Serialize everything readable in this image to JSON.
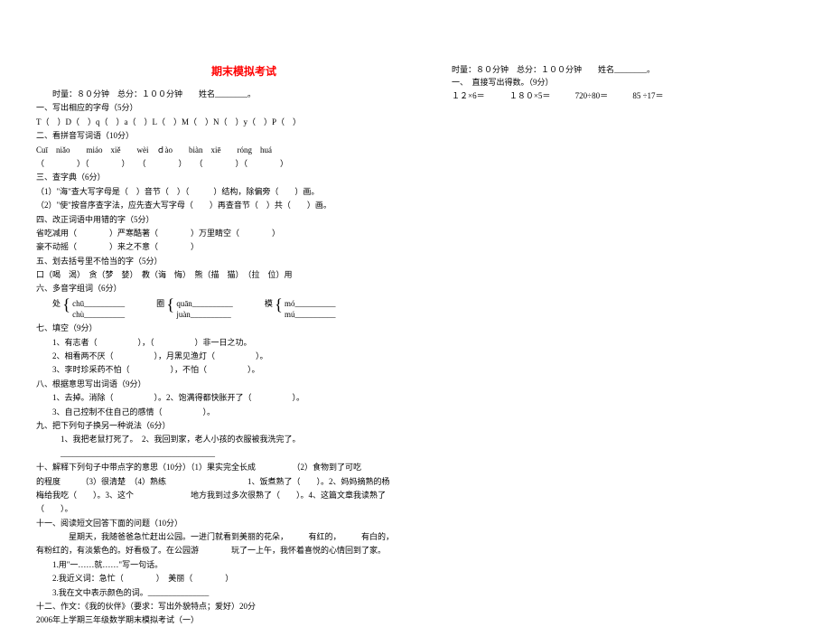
{
  "title": "期末模拟考试",
  "left": {
    "header_info": "时量：８０分钟　总分：１００分钟　　姓名________。",
    "section1_title": "一、写出相应的字母（5分）",
    "section1_content": "T（　）D（　）q（　）a（　）L（　）M（　）N（　）y（　）P（　）",
    "section2_title": "二、看拼音写词语（10分）",
    "section2_pinyin": "Cuī　niǎo　　miáo　xiě　　wèi　ｄào　　biàn　xiē　　róng　huá",
    "section2_blanks": "（　　　　）（　　　　）　　（　　　　）　　（　　　　）（　　　　）",
    "section3_title": "三、查字典（6分）",
    "section3_line1": "（1）\"海\"查大写字母是（　）音节（　）（　　　）结构，除偏旁（　　）画。",
    "section3_line2": "（2）\"使\"按音序查字法，应先查大写字母（　　）再查音节（　）共（　　）画。",
    "section4_title": "四、改正词语中用错的字（5分）",
    "section4_line1": "省吃减用（　　　　）严寒酷著（　　　　）万里睛空（　　　　）",
    "section4_line2": "豪不动摇（　　　　）来之不意（　　　　）",
    "section5_title": "五、划去括号里不恰当的字（5分）",
    "section5_content": "口（喝　渴）　贪（梦　婪）　教（诲　悔）　熊（描　猫）　（拉　位）用",
    "section6_title": "六、多音字组词（6分）",
    "section6_char1": "处",
    "section6_pinyin1a": "chū__________",
    "section6_pinyin1b": "chù__________",
    "section6_char2": "圈",
    "section6_pinyin2a": "quān__________",
    "section6_pinyin2b": "juàn__________",
    "section6_char3": "模",
    "section6_pinyin3a": "mó__________",
    "section6_pinyin3b": "mú__________",
    "section7_title": "七、填空（9分）",
    "section7_line1": "1、有志者（　　　　　），（　　　　　）非一日之功。",
    "section7_line2": "2、相看两不厌（　　　　　），月黑见渔灯（　　　　　）。",
    "section7_line3": "3、李时珍采药不怕（　　　　　），不怕（　　　　　）。",
    "section8_title": "八、根据意思写出词语（9分）",
    "section8_line1": "1、去掉。消除（　　　　　）。2、饱满得都快胀开了（　　　　　）。",
    "section8_line2": "3、自己控制不住自己的感情（　　　　　）。",
    "section9_title": "九、把下列句子换另一种说法（6分）",
    "section9_line1": "　1、我把老鼠打死了。　2、我回到家，老人小孩的衣服被我洗完了。",
    "section9_blank": "　______________________________________",
    "section10_title": "十、解释下列句子中带点字的意思（10分）（1）果实完全长成　　　　　（2）食物到了可吃",
    "section10_line1": "的程度　　　（3）很清楚　（4）熟练　　　　　　　　　　1、饭煮熟了（　　）。2、妈妈摘熟的杨",
    "section10_line2": "梅给我吃（　　）。3、这个　　　　　　　地方我到过多次很熟了（　　）。4、这篇文章我读熟了",
    "section10_line3": "（　　）。",
    "section11_title": "十一、阅读短文回答下面的问题（10分）",
    "section11_line1": "　　　　星期天，我随爸爸急忙赶出公园。一进门就看到美丽的花朵，　　　有红的，　　　有白的，",
    "section11_line2": "有粉红的，有淡紫色的。好看极了。在公园游　　　　玩了一上午，我怀着喜悦的心情回到了家。",
    "section11_q1": "1.用\"一……就……\"写一句话。",
    "section11_q2": "2.我近义词：急忙（　　　　）　美丽（　　　　）",
    "section11_q3": "3.我在文中表示颜色的词。_______________",
    "section12": "十二、作文：《我的伙伴》（要求：写出外貌特点；爱好）20分",
    "footer": "2006年上学期三年级数学期末模拟考试（一）"
  },
  "right": {
    "header_info": "时量：８０分钟　总分：１００分钟　　姓名________。",
    "section1_title": "一、　直接写出得数。（9分）",
    "eq1": "１２×6＝",
    "eq2": "１８０×5＝",
    "eq3": "720÷80＝",
    "eq4": "85 ÷17＝"
  }
}
